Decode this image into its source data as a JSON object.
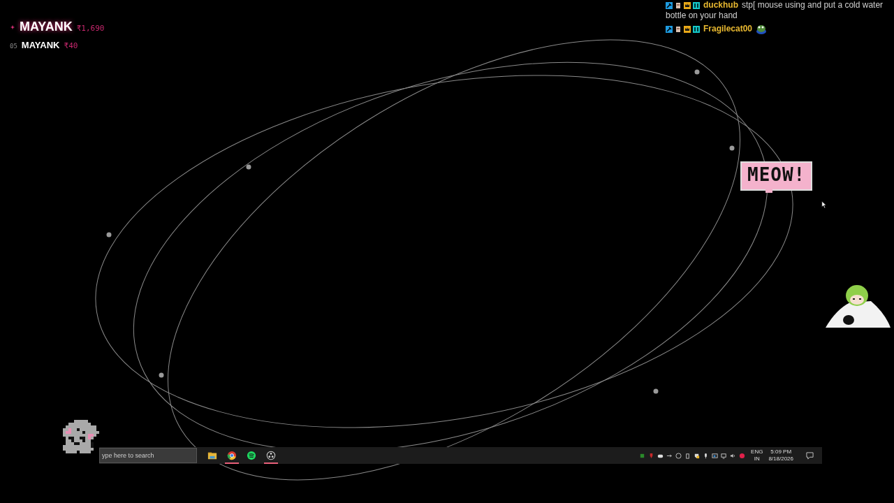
{
  "leaderboard": [
    {
      "kind": "top",
      "name": "MAYANK",
      "amount": "₹1,690"
    },
    {
      "kind": "recent",
      "rank": "05",
      "name": "MAYANK",
      "amount": "₹40"
    }
  ],
  "chat": [
    {
      "user": "duckhub",
      "message_lines": [
        "stp[ mouse using and put a cold water",
        "bottle on your hand"
      ],
      "has_emote": false
    },
    {
      "user": "Fragilecat00",
      "has_emote": true
    }
  ],
  "speech_bubble": {
    "text": "MEOW!"
  },
  "taskbar": {
    "search": {
      "placeholder": "ype here to search"
    },
    "apps": [
      {
        "kind": "folder",
        "running": false
      },
      {
        "kind": "browser",
        "running": true
      },
      {
        "kind": "music",
        "running": false
      },
      {
        "kind": "aperture",
        "running": true
      }
    ],
    "language": [
      "ENG",
      "IN"
    ],
    "clock": {
      "time": "5:09 PM",
      "date": "8/18/2026"
    }
  }
}
